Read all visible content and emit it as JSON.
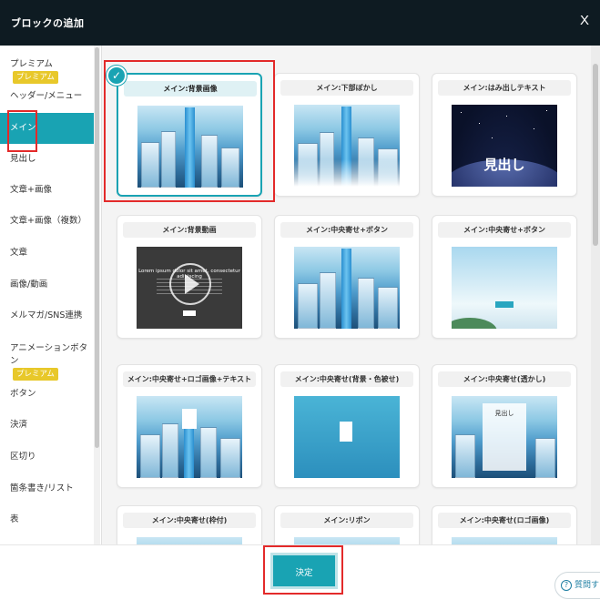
{
  "modal": {
    "title": "ブロックの追加",
    "close_label": "X"
  },
  "sidebar": {
    "items": [
      {
        "label": "プレミアム",
        "badge": "プレミアム"
      },
      {
        "label": "ヘッダー/メニュー"
      },
      {
        "label": "メイン",
        "active": true
      },
      {
        "label": "見出し"
      },
      {
        "label": "文章+画像"
      },
      {
        "label": "文章+画像（複数）"
      },
      {
        "label": "文章"
      },
      {
        "label": "画像/動画"
      },
      {
        "label": "メルマガ/SNS連携"
      },
      {
        "label": "アニメーションボタン",
        "badge": "プレミアム"
      },
      {
        "label": "ボタン"
      },
      {
        "label": "決済"
      },
      {
        "label": "区切り"
      },
      {
        "label": "箇条書き/リスト"
      },
      {
        "label": "表"
      }
    ]
  },
  "blocks": [
    {
      "label": "メイン:背景画像",
      "selected": true
    },
    {
      "label": "メイン:下部ぼかし"
    },
    {
      "label": "メイン:はみ出しテキスト",
      "thumb_text": "見出し"
    },
    {
      "label": "メイン:背景動画",
      "thumb_text": "Lorem ipsum dolor sit amet, consectetur adipiscing"
    },
    {
      "label": "メイン:中央寄せ+ボタン"
    },
    {
      "label": "メイン:中央寄せ+ボタン"
    },
    {
      "label": "メイン:中央寄せ+ロゴ画像+テキスト"
    },
    {
      "label": "メイン:中央寄せ(背景・色被せ)"
    },
    {
      "label": "メイン:中央寄せ(透かし)",
      "thumb_text": "見出し"
    },
    {
      "label": "メイン:中央寄せ(枠付)"
    },
    {
      "label": "メイン:リボン"
    },
    {
      "label": "メイン:中央寄せ(ロゴ画像)"
    }
  ],
  "footer": {
    "confirm_label": "決定"
  },
  "help": {
    "label": "質問する"
  },
  "colors": {
    "accent": "#19a3b3",
    "header_bg": "#0e1b22",
    "badge": "#e8c82a",
    "highlight": "#e32a2a"
  }
}
